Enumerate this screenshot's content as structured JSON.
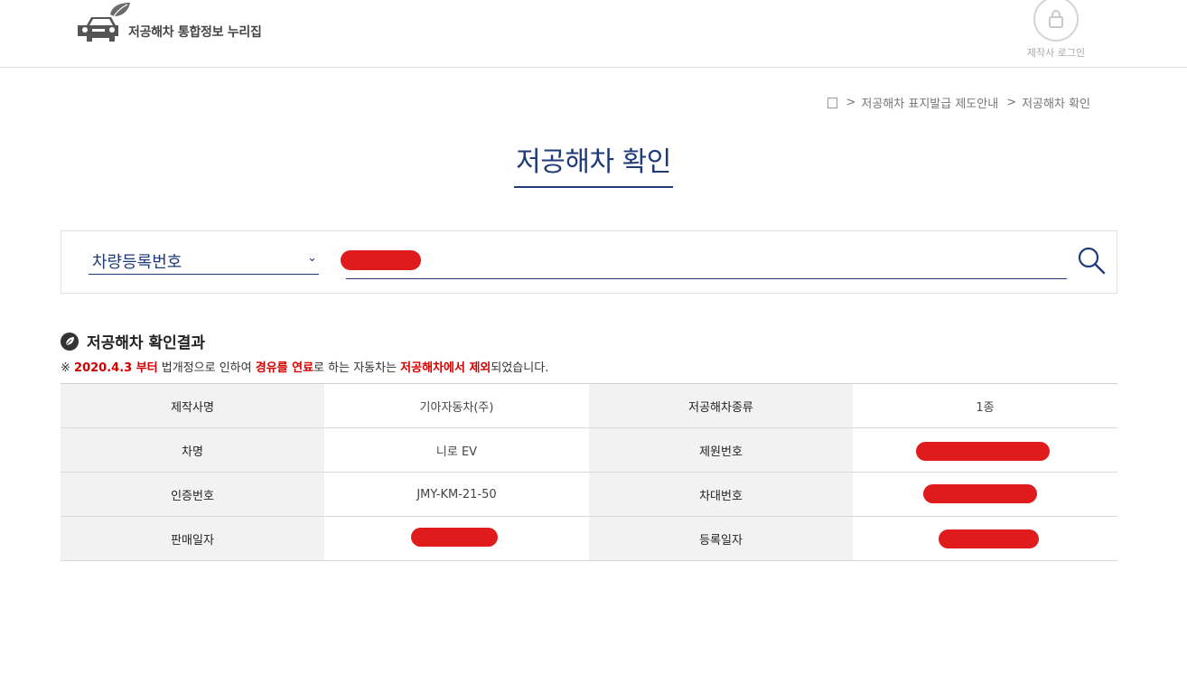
{
  "header": {
    "site_title": "저공해차 통합정보 누리집",
    "login_label": "제작사 로그인"
  },
  "breadcrumb": {
    "sep": ">",
    "item1": "저공해차 표지발급 제도안내",
    "item2": "저공해차 확인"
  },
  "page_title": "저공해차 확인",
  "search": {
    "type_selected": "차량등록번호",
    "query_value": "[redacted]"
  },
  "result": {
    "title": "저공해차 확인결과",
    "notice": {
      "prefix": "※ ",
      "date": "2020.4.3 부터",
      "part1": " 법개정으로 인하여 ",
      "fuel": "경유를 연료",
      "part2": "로 하는 자동차는 ",
      "excluded": "저공해차에서 제외",
      "part3": "되었습니다."
    },
    "table": {
      "r1": {
        "l1": "제작사명",
        "v1": "기아자동차(주)",
        "l2": "저공해차종류",
        "v2": "1종"
      },
      "r2": {
        "l1": "차명",
        "v1": "니로 EV",
        "l2": "제원번호",
        "v2": "[redacted]"
      },
      "r3": {
        "l1": "인증번호",
        "v1": "JMY-KM-21-50",
        "l2": "차대번호",
        "v2": "[redacted]"
      },
      "r4": {
        "l1": "판매일자",
        "v1": "[redacted]",
        "l2": "등록일자",
        "v2": "[redacted]"
      }
    }
  },
  "colors": {
    "accent": "#1e3a78",
    "warning": "#d40000",
    "redaction": "#e01b1b"
  },
  "icons": [
    "car-leaf-logo-icon",
    "lock-icon",
    "home-icon",
    "chevron-down-icon",
    "search-icon",
    "leaf-bullet-icon"
  ]
}
